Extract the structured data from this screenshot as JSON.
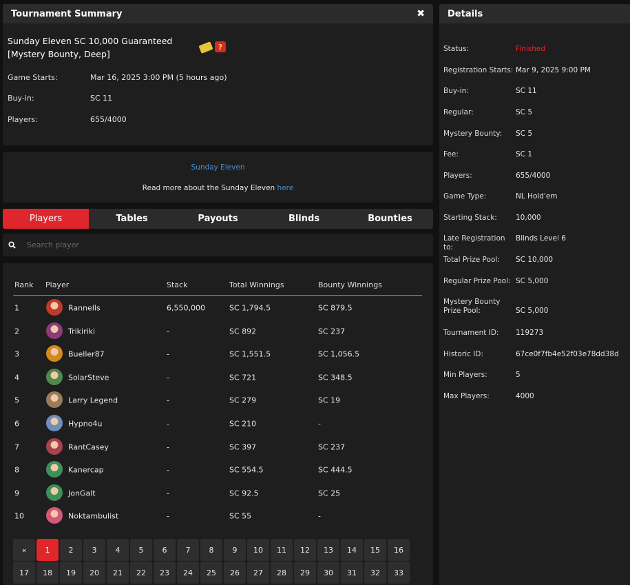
{
  "summary": {
    "header": "Tournament Summary",
    "close_glyph": "✖",
    "title": "Sunday Eleven SC 10,000 Guaranteed [Mystery Bounty, Deep]",
    "mystery_glyph": "?",
    "rows": [
      {
        "label": "Game Starts:",
        "value": "Mar 16, 2025 3:00 PM (5 hours ago)"
      },
      {
        "label": "Buy-in:",
        "value": "SC 11"
      },
      {
        "label": "Players:",
        "value": "655/4000"
      }
    ]
  },
  "info": {
    "link": "Sunday Eleven",
    "text_prefix": "Read more about the Sunday Eleven ",
    "text_link": "here"
  },
  "tabs": [
    "Players",
    "Tables",
    "Payouts",
    "Blinds",
    "Bounties"
  ],
  "active_tab": "Players",
  "search": {
    "placeholder": "Search player"
  },
  "players": {
    "columns": [
      "Rank",
      "Player",
      "Stack",
      "Total Winnings",
      "Bounty Winnings"
    ],
    "rows": [
      {
        "rank": "1",
        "player": "Rannells",
        "stack": "6,550,000",
        "total": "SC 1,794.5",
        "bounty": "SC 879.5",
        "avatar_color": "#c0392b"
      },
      {
        "rank": "2",
        "player": "Trikiriki",
        "stack": "-",
        "total": "SC 892",
        "bounty": "SC 237",
        "avatar_color": "#8e3b7a"
      },
      {
        "rank": "3",
        "player": "Bueller87",
        "stack": "-",
        "total": "SC 1,551.5",
        "bounty": "SC 1,056.5",
        "avatar_color": "#d08a1e"
      },
      {
        "rank": "4",
        "player": "SolarSteve",
        "stack": "-",
        "total": "SC 721",
        "bounty": "SC 348.5",
        "avatar_color": "#4f8a4a"
      },
      {
        "rank": "5",
        "player": "Larry Legend",
        "stack": "-",
        "total": "SC 279",
        "bounty": "SC 19",
        "avatar_color": "#9a7b5a"
      },
      {
        "rank": "6",
        "player": "Hypno4u",
        "stack": "-",
        "total": "SC 210",
        "bounty": "-",
        "avatar_color": "#6f8fb8"
      },
      {
        "rank": "7",
        "player": "RantCasey",
        "stack": "-",
        "total": "SC 397",
        "bounty": "SC 237",
        "avatar_color": "#a8434d"
      },
      {
        "rank": "8",
        "player": "Kanercap",
        "stack": "-",
        "total": "SC 554.5",
        "bounty": "SC 444.5",
        "avatar_color": "#3f8f5a"
      },
      {
        "rank": "9",
        "player": "JonGalt",
        "stack": "-",
        "total": "SC 92.5",
        "bounty": "SC 25",
        "avatar_color": "#3f8f5a"
      },
      {
        "rank": "10",
        "player": "Noktambulist",
        "stack": "-",
        "total": "SC 55",
        "bounty": "-",
        "avatar_color": "#d4577a"
      }
    ]
  },
  "pagination": {
    "prev": "«",
    "active": "1",
    "row1": [
      "1",
      "2",
      "3",
      "4",
      "5",
      "6",
      "7",
      "8",
      "9",
      "10",
      "11",
      "12",
      "13",
      "14",
      "15",
      "16"
    ],
    "row2": [
      "17",
      "18",
      "19",
      "20",
      "21",
      "22",
      "23",
      "24",
      "25",
      "26",
      "27",
      "28",
      "29",
      "30",
      "31",
      "32",
      "33"
    ]
  },
  "details": {
    "header": "Details",
    "rows": [
      {
        "label": "Status:",
        "value": "Finished",
        "status": true
      },
      {
        "label": "Registration Starts:",
        "value": "Mar 9, 2025 9:00 PM"
      },
      {
        "label": "Buy-in:",
        "value": "SC 11"
      },
      {
        "label": "Regular:",
        "value": "SC 5"
      },
      {
        "label": "Mystery Bounty:",
        "value": "SC 5"
      },
      {
        "label": "Fee:",
        "value": "SC 1"
      },
      {
        "label": "Players:",
        "value": "655/4000"
      },
      {
        "label": "Game Type:",
        "value": "NL Hold'em"
      },
      {
        "label": "Starting Stack:",
        "value": "10,000"
      },
      {
        "label": "Late Registration to:",
        "value": "Blinds Level 6"
      },
      {
        "label": "Total Prize Pool:",
        "value": "SC 10,000"
      },
      {
        "label": "Regular Prize Pool:",
        "value": "SC 5,000"
      },
      {
        "label": "Mystery Bounty Prize Pool:",
        "value": "SC 5,000"
      },
      {
        "label": "Tournament ID:",
        "value": "119273"
      },
      {
        "label": "Historic ID:",
        "value": "67ce0f7fb4e52f03e78dd38d"
      },
      {
        "label": "Min Players:",
        "value": "5"
      },
      {
        "label": "Max Players:",
        "value": "4000"
      }
    ]
  },
  "colors": {
    "accent": "#e0262d",
    "link": "#4a8fd6"
  }
}
